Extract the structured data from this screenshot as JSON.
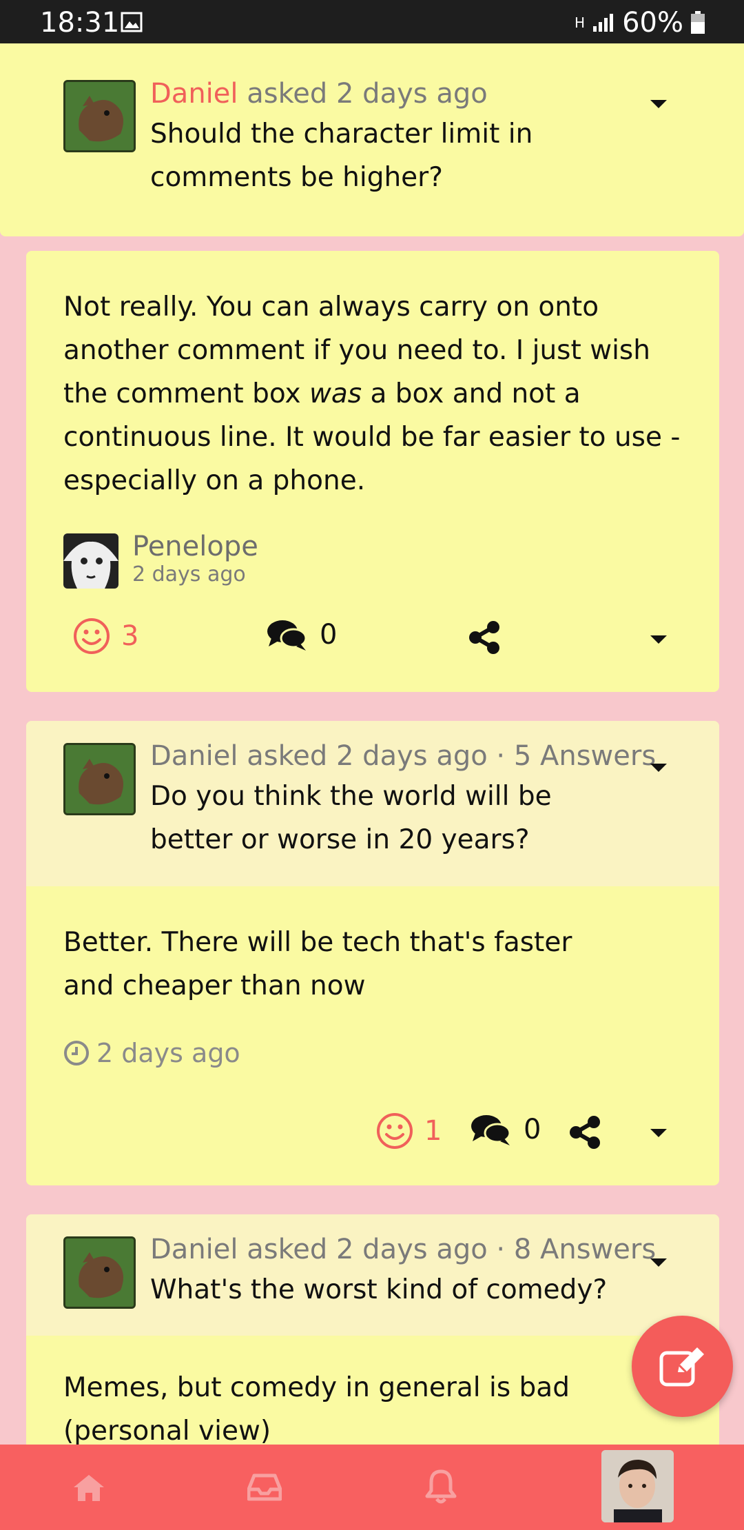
{
  "status_bar": {
    "time": "18:31",
    "network": "H",
    "battery": "60%"
  },
  "question_top": {
    "user": "Daniel",
    "meta": " asked 2 days ago",
    "text": "Should the character limit in comments be higher?"
  },
  "answer_1": {
    "text_a": "Not really. You can always carry on onto another comment if you need to. I just wish the comment box ",
    "text_em": "was",
    "text_b": " a box and not a continuous line. It would be far easier to use - especially on a phone.",
    "author": "Penelope",
    "time": "2 days ago",
    "likes": "3",
    "comments": "0"
  },
  "card_2": {
    "meta": "Daniel asked 2 days ago · 5 Answers",
    "question": "Do you think the world will be better or worse in 20 years?",
    "answer": "Better. There will be tech that's faster and cheaper than now",
    "time": "2 days ago",
    "likes": "1",
    "comments": "0"
  },
  "card_3": {
    "meta": "Daniel asked 2 days ago · 8 Answers",
    "question": "What's the worst kind of comedy?",
    "answer": "Memes, but comedy in general is bad (personal view)"
  },
  "colors": {
    "accent_red": "#f86060",
    "card_yellow": "#fafaa2",
    "card_header": "#faf3c2",
    "background_pink": "#f8c8cc"
  },
  "icons": {
    "fab": "edit-icon",
    "nav": [
      "home-icon",
      "inbox-icon",
      "bell-icon",
      "profile-avatar"
    ]
  }
}
